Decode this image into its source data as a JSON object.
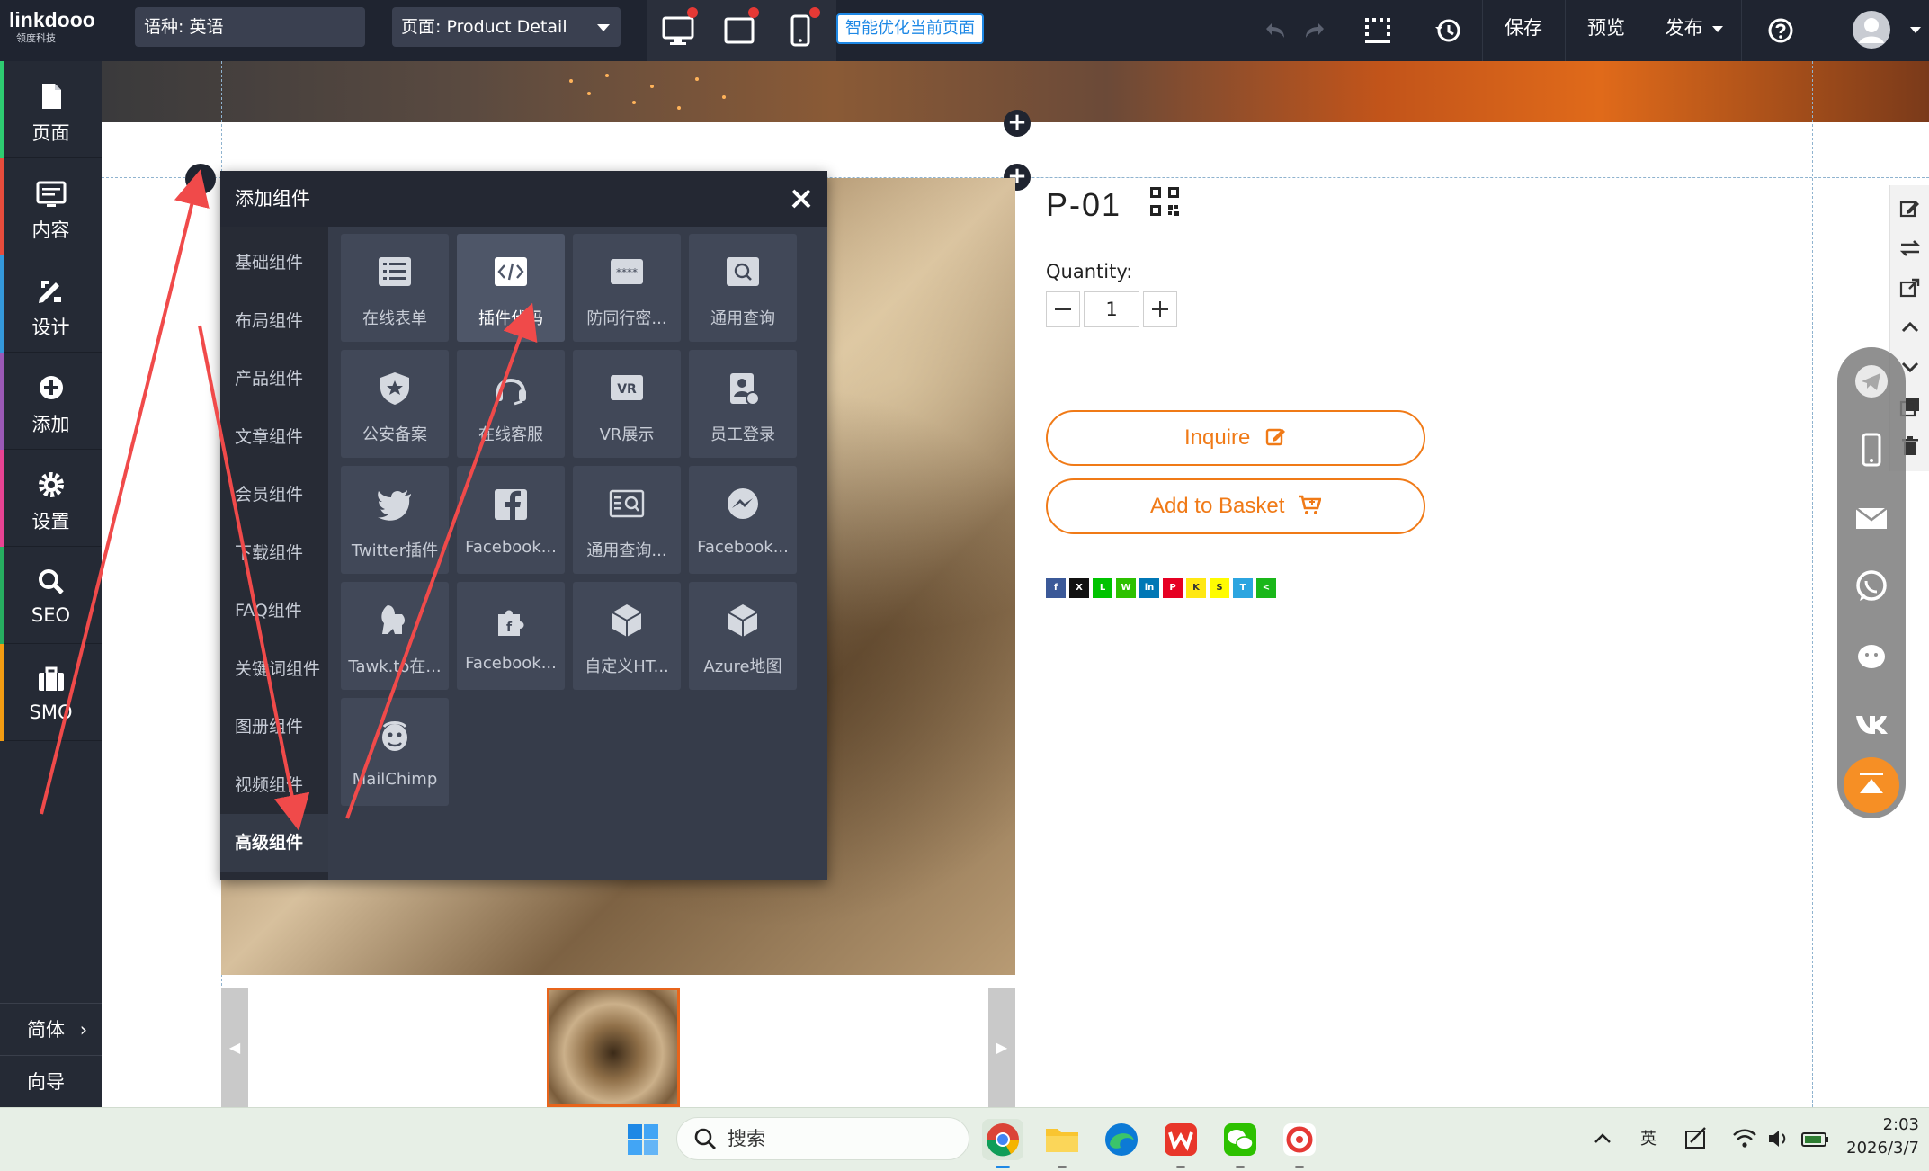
{
  "topbar": {
    "logo_main": "linkdooo",
    "logo_sub": "领度科技",
    "language_select": "语种:  英语",
    "page_select": "页面:  Product Detail",
    "smart_optimize": "智能优化当前页面",
    "save": "保存",
    "preview": "预览",
    "publish": "发布"
  },
  "sidebar": {
    "items": [
      {
        "label": "页面",
        "icon": "file-icon",
        "color": "#2ecc71"
      },
      {
        "label": "内容",
        "icon": "content-icon",
        "color": "#e74c3c"
      },
      {
        "label": "设计",
        "icon": "design-icon",
        "color": "#3498db"
      },
      {
        "label": "添加",
        "icon": "add-icon",
        "color": "#9b59b6"
      },
      {
        "label": "设置",
        "icon": "gear-icon",
        "color": "#e84393"
      },
      {
        "label": "SEO",
        "icon": "search-icon",
        "color": "#27ae60"
      },
      {
        "label": "SMO",
        "icon": "briefcase-icon",
        "color": "#f39c12"
      }
    ],
    "lang": "简体",
    "guide": "向导"
  },
  "panel": {
    "title": "添加组件",
    "categories": [
      "基础组件",
      "布局组件",
      "产品组件",
      "文章组件",
      "会员组件",
      "下载组件",
      "FAQ组件",
      "关键词组件",
      "图册组件",
      "视频组件",
      "高级组件"
    ],
    "active_category": "高级组件",
    "tiles": [
      {
        "label": "在线表单",
        "icon": "form-icon"
      },
      {
        "label": "插件代码",
        "icon": "code-icon"
      },
      {
        "label": "防同行密...",
        "icon": "password-icon"
      },
      {
        "label": "通用查询",
        "icon": "query-icon"
      },
      {
        "label": "公安备案",
        "icon": "police-badge-icon"
      },
      {
        "label": "在线客服",
        "icon": "headset-icon"
      },
      {
        "label": "VR展示",
        "icon": "vr-icon"
      },
      {
        "label": "员工登录",
        "icon": "employee-login-icon"
      },
      {
        "label": "Twitter插件",
        "icon": "twitter-icon"
      },
      {
        "label": "Facebook...",
        "icon": "facebook-icon"
      },
      {
        "label": "通用查询...",
        "icon": "list-search-icon"
      },
      {
        "label": "Facebook...",
        "icon": "messenger-icon"
      },
      {
        "label": "Tawk.to在...",
        "icon": "tawk-icon"
      },
      {
        "label": "Facebook...",
        "icon": "puzzle-icon"
      },
      {
        "label": "自定义HT...",
        "icon": "cube-icon"
      },
      {
        "label": "Azure地图",
        "icon": "cube-icon"
      },
      {
        "label": "MailChimp",
        "icon": "mailchimp-icon"
      }
    ]
  },
  "product": {
    "title": "P-01",
    "quantity_label": "Quantity:",
    "quantity_value": "1",
    "inquire": "Inquire",
    "add_to_basket": "Add to Basket",
    "share": [
      {
        "name": "facebook",
        "glyph": "f",
        "color": "#3b5998"
      },
      {
        "name": "x",
        "glyph": "X",
        "color": "#111111"
      },
      {
        "name": "line",
        "glyph": "L",
        "color": "#00c300"
      },
      {
        "name": "wechat",
        "glyph": "W",
        "color": "#2dc100"
      },
      {
        "name": "linkedin",
        "glyph": "in",
        "color": "#0077b5"
      },
      {
        "name": "pinterest",
        "glyph": "P",
        "color": "#e60023"
      },
      {
        "name": "kakaotalk",
        "glyph": "K",
        "color": "#ffe812"
      },
      {
        "name": "snapchat",
        "glyph": "S",
        "color": "#fffc00"
      },
      {
        "name": "telegram",
        "glyph": "T",
        "color": "#2ca5e0"
      },
      {
        "name": "sharethis",
        "glyph": "<",
        "color": "#1ab71a"
      }
    ]
  },
  "taskbar": {
    "search": "搜索",
    "ime": "英",
    "time": "2:03",
    "date": "2026/3/7"
  },
  "colors": {
    "accent_orange": "#f07a17",
    "annotation_red": "#f04a4a",
    "topbar_bg": "#1f2430"
  }
}
